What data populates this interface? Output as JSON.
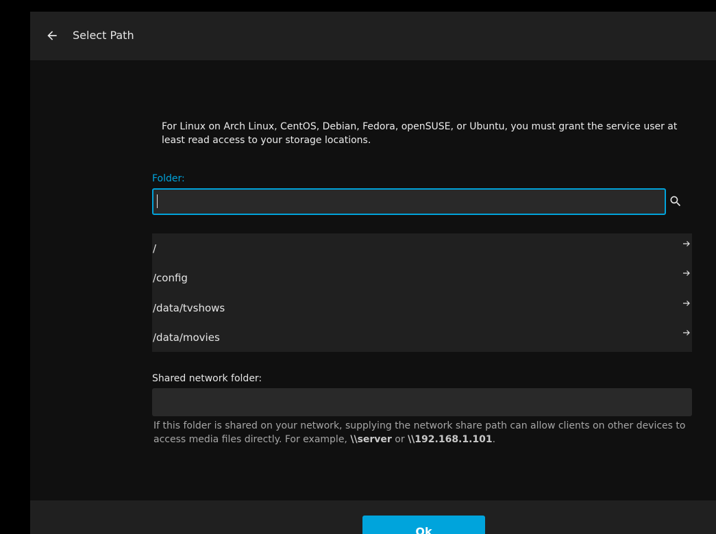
{
  "header": {
    "title": "Select Path",
    "back_icon": "arrow-back-icon"
  },
  "instructions": "For Linux on Arch Linux, CentOS, Debian, Fedora, openSUSE, or Ubuntu, you must grant the service user at least read access to your storage locations.",
  "folder": {
    "label": "Folder:",
    "value": "",
    "search_icon": "search-icon"
  },
  "directories": [
    {
      "label": "/",
      "icon": "arrow-forward-icon"
    },
    {
      "label": "/config",
      "icon": "arrow-forward-icon"
    },
    {
      "label": "/data/tvshows",
      "icon": "arrow-forward-icon"
    },
    {
      "label": "/data/movies",
      "icon": "arrow-forward-icon"
    }
  ],
  "network_share": {
    "label": "Shared network folder:",
    "value": "",
    "help_before": "If this folder is shared on your network, supplying the network share path can allow clients on other devices to access media files directly. For example, ",
    "example_server": "\\\\server",
    "help_or": " or ",
    "example_ip": "\\\\192.168.1.101",
    "help_after": "."
  },
  "footer": {
    "ok_label": "Ok"
  },
  "colors": {
    "accent": "#00a4dc",
    "background": "#101010",
    "header": "#202020"
  }
}
